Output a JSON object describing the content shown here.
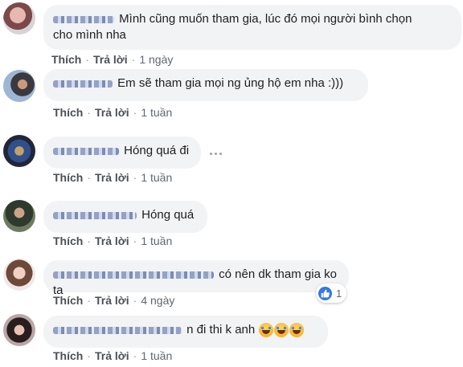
{
  "comments": [
    {
      "text_line1": "Mình cũng muốn tham gia, lúc đó mọi người bình chọn",
      "text_line2": "cho mình nha",
      "like": "Thích",
      "reply": "Trả lời",
      "time": "1 ngày"
    },
    {
      "text_line1": "Em sẽ tham gia mọi ng ủng hộ em nha :)))",
      "like": "Thích",
      "reply": "Trả lời",
      "time": "1 tuần"
    },
    {
      "text_line1": "Hóng quá đi",
      "like": "Thích",
      "reply": "Trả lời",
      "time": "1 tuần"
    },
    {
      "text_line1": "Hóng quá",
      "like": "Thích",
      "reply": "Trả lời",
      "time": "1 tuần"
    },
    {
      "text_line1": "có nên dk tham gia ko ta",
      "like": "Thích",
      "reply": "Trả lời",
      "time": "4 ngày",
      "reaction_count": "1"
    },
    {
      "text_line1": "n đi thi k anh",
      "like": "Thích",
      "reply": "Trả lời",
      "time": "1 tuần"
    }
  ],
  "icons": {
    "reaction": "like-icon",
    "emoji": "laughing-tears-emoji-icon",
    "more": "more-options-icon"
  },
  "colors": {
    "bubble": "#f2f3f5",
    "like_blue": "#3578e5",
    "action_text": "#4b4f56"
  }
}
